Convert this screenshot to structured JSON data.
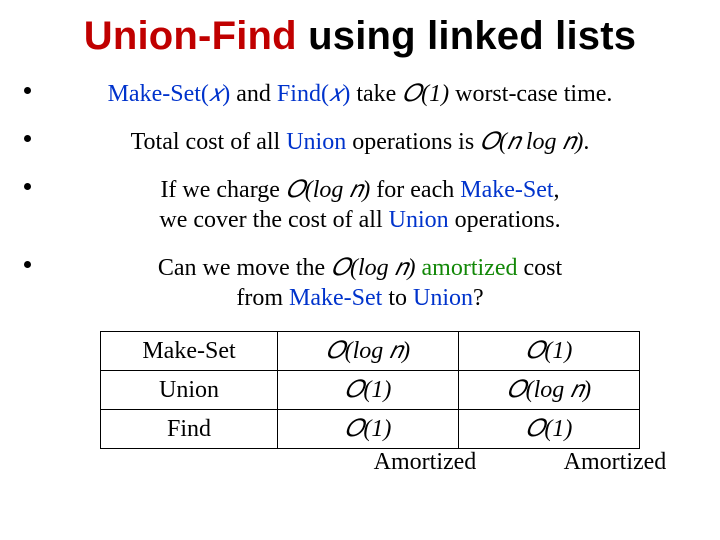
{
  "title": {
    "part1": "Union-Find",
    "part2": " using linked lists"
  },
  "bullets": [
    {
      "pre": "Make-Set(",
      "arg": "𝑥",
      "mid1": ") ",
      "conj": "and ",
      "find_pre": "Find(",
      "find_arg": "𝑥",
      "find_post": ") ",
      "mid2": "take ",
      "complexity": "𝑂(1)",
      "post": " worst-case time."
    },
    {
      "pre": "Total cost of all ",
      "union": "Union",
      "mid": " operations is ",
      "complexity": "𝑂(𝑛 log 𝑛)",
      "post": "."
    },
    {
      "line1_pre": "If we charge ",
      "line1_cx": "𝑂(log 𝑛)",
      "line1_mid": " for each ",
      "line1_op": "Make-Set",
      "line1_post": ",",
      "line2_pre": "we cover the cost of all ",
      "line2_union": "Union",
      "line2_post": " operations."
    },
    {
      "line1_pre": "Can we move the ",
      "line1_cx": "𝑂(log 𝑛)",
      "line1_sp": " ",
      "line1_am": "amortized",
      "line1_post": " cost",
      "line2_pre": "from ",
      "line2_ms": "Make-Set",
      "line2_mid": " to ",
      "line2_union": "Union",
      "line2_post": "?"
    }
  ],
  "table": {
    "rows": [
      {
        "op": "Make-Set",
        "c1": "𝑂(log 𝑛)",
        "c2": "𝑂(1)"
      },
      {
        "op": "Union",
        "c1": "𝑂(1)",
        "c2": "𝑂(log 𝑛)"
      },
      {
        "op": "Find",
        "c1": "𝑂(1)",
        "c2": "𝑂(1)"
      }
    ],
    "footer": {
      "c1": "Amortized",
      "c2": "Amortized"
    }
  }
}
